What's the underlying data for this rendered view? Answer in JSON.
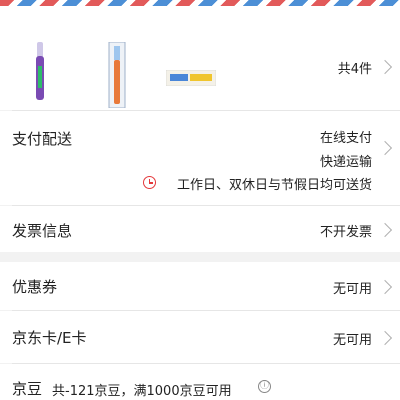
{
  "products": {
    "items": [
      {
        "name": "toothbrush-purple",
        "color": "#7a4bb3"
      },
      {
        "name": "toothbrush-orange",
        "color": "#e8793a"
      },
      {
        "name": "toothpaste",
        "color": "#4a86d8"
      }
    ],
    "count_label": "共4件"
  },
  "payment_delivery": {
    "label": "支付配送",
    "payment_method": "在线支付",
    "delivery_method": "快递运输",
    "delivery_time": "工作日、双休日与节假日均可送货"
  },
  "invoice": {
    "label": "发票信息",
    "value": "不开发票"
  },
  "coupon": {
    "label": "优惠券",
    "value": "无可用"
  },
  "jd_card": {
    "label": "京东卡/E卡",
    "value": "无可用"
  },
  "jd_beans": {
    "label": "京豆",
    "info": "共-121京豆，满1000京豆可用",
    "info_icon": "ⓘ"
  },
  "colors": {
    "accent": "#e4393c"
  }
}
